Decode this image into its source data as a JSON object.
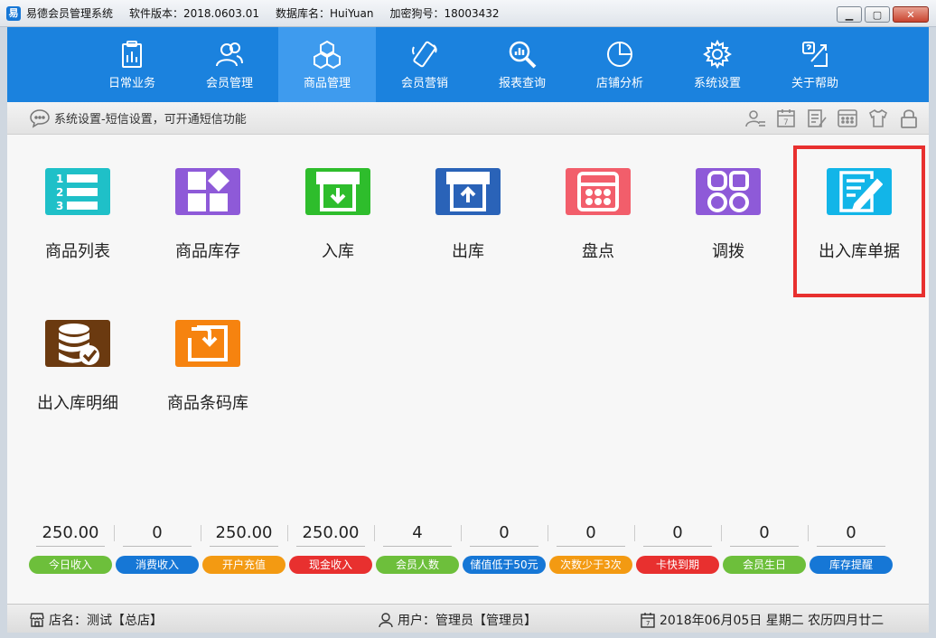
{
  "titlebar": {
    "app_name": "易德会员管理系统",
    "version": "软件版本：2018.0603.01",
    "database": "数据库名：HuiYuan",
    "dongle": "加密狗号：18003432"
  },
  "nav": [
    {
      "label": "日常业务",
      "icon": "clipboard-chart-icon"
    },
    {
      "label": "会员管理",
      "icon": "users-icon"
    },
    {
      "label": "商品管理",
      "icon": "cubes-icon"
    },
    {
      "label": "会员营销",
      "icon": "phone-icon"
    },
    {
      "label": "报表查询",
      "icon": "magnifier-chart-icon"
    },
    {
      "label": "店铺分析",
      "icon": "pie-chart-icon"
    },
    {
      "label": "系统设置",
      "icon": "gear-icon"
    },
    {
      "label": "关于帮助",
      "icon": "help-icon"
    }
  ],
  "infobar": {
    "message": "系统设置-短信设置，可开通短信功能"
  },
  "tiles": [
    {
      "label": "商品列表",
      "color": "#1fc0c8"
    },
    {
      "label": "商品库存",
      "color": "#8e5ad8"
    },
    {
      "label": "入库",
      "color": "#2ebd2c"
    },
    {
      "label": "出库",
      "color": "#2a63b8"
    },
    {
      "label": "盘点",
      "color": "#f25e6b"
    },
    {
      "label": "调拨",
      "color": "#8e5ad8"
    },
    {
      "label": "出入库单据",
      "color": "#12b5e8"
    },
    {
      "label": "出入库明细",
      "color": "#6b3a10"
    },
    {
      "label": "商品条码库",
      "color": "#f6830f"
    }
  ],
  "stats": [
    {
      "value": "250.00",
      "label": "今日收入",
      "color": "#6dbf3b"
    },
    {
      "value": "0",
      "label": "消费收入",
      "color": "#1677d6"
    },
    {
      "value": "250.00",
      "label": "开户充值",
      "color": "#f39a12"
    },
    {
      "value": "250.00",
      "label": "现金收入",
      "color": "#e8302f"
    },
    {
      "value": "4",
      "label": "会员人数",
      "color": "#6dbf3b"
    },
    {
      "value": "0",
      "label": "储值低于50元",
      "color": "#1677d6"
    },
    {
      "value": "0",
      "label": "次数少于3次",
      "color": "#f39a12"
    },
    {
      "value": "0",
      "label": "卡快到期",
      "color": "#e8302f"
    },
    {
      "value": "0",
      "label": "会员生日",
      "color": "#6dbf3b"
    },
    {
      "value": "0",
      "label": "库存提醒",
      "color": "#1677d6"
    }
  ],
  "statusbar": {
    "store": "店名：测试【总店】",
    "user": "用户：管理员【管理员】",
    "date": "2018年06月05日 星期二 农历四月廿二"
  }
}
